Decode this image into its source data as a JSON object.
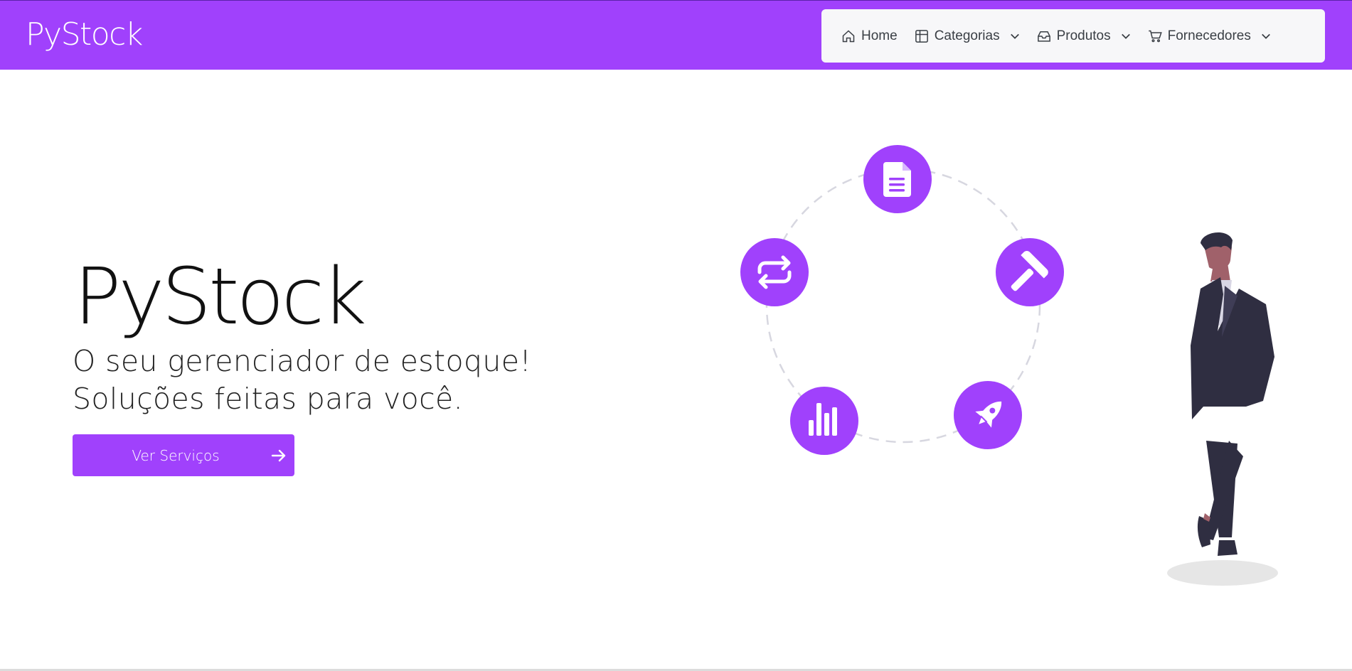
{
  "app": {
    "brand": "PyStock"
  },
  "nav": {
    "items": [
      {
        "label": "Home",
        "icon": "home-icon"
      },
      {
        "label": "Categorias",
        "icon": "grid-icon"
      },
      {
        "label": "Produtos",
        "icon": "inbox-icon"
      },
      {
        "label": "Fornecedores",
        "icon": "cart-icon"
      }
    ]
  },
  "hero": {
    "title": "PyStock",
    "line1": "O seu gerenciador de estoque!",
    "line2": "Soluções feitas para você.",
    "cta_label": "Ver Serviços"
  },
  "colors": {
    "accent": "#a041fc",
    "text": "#111111",
    "nav_bg": "#f7f7f9"
  },
  "illustration": {
    "icons": [
      "document-icon",
      "hammer-icon",
      "rocket-icon",
      "bar-chart-icon",
      "repeat-icon"
    ]
  }
}
